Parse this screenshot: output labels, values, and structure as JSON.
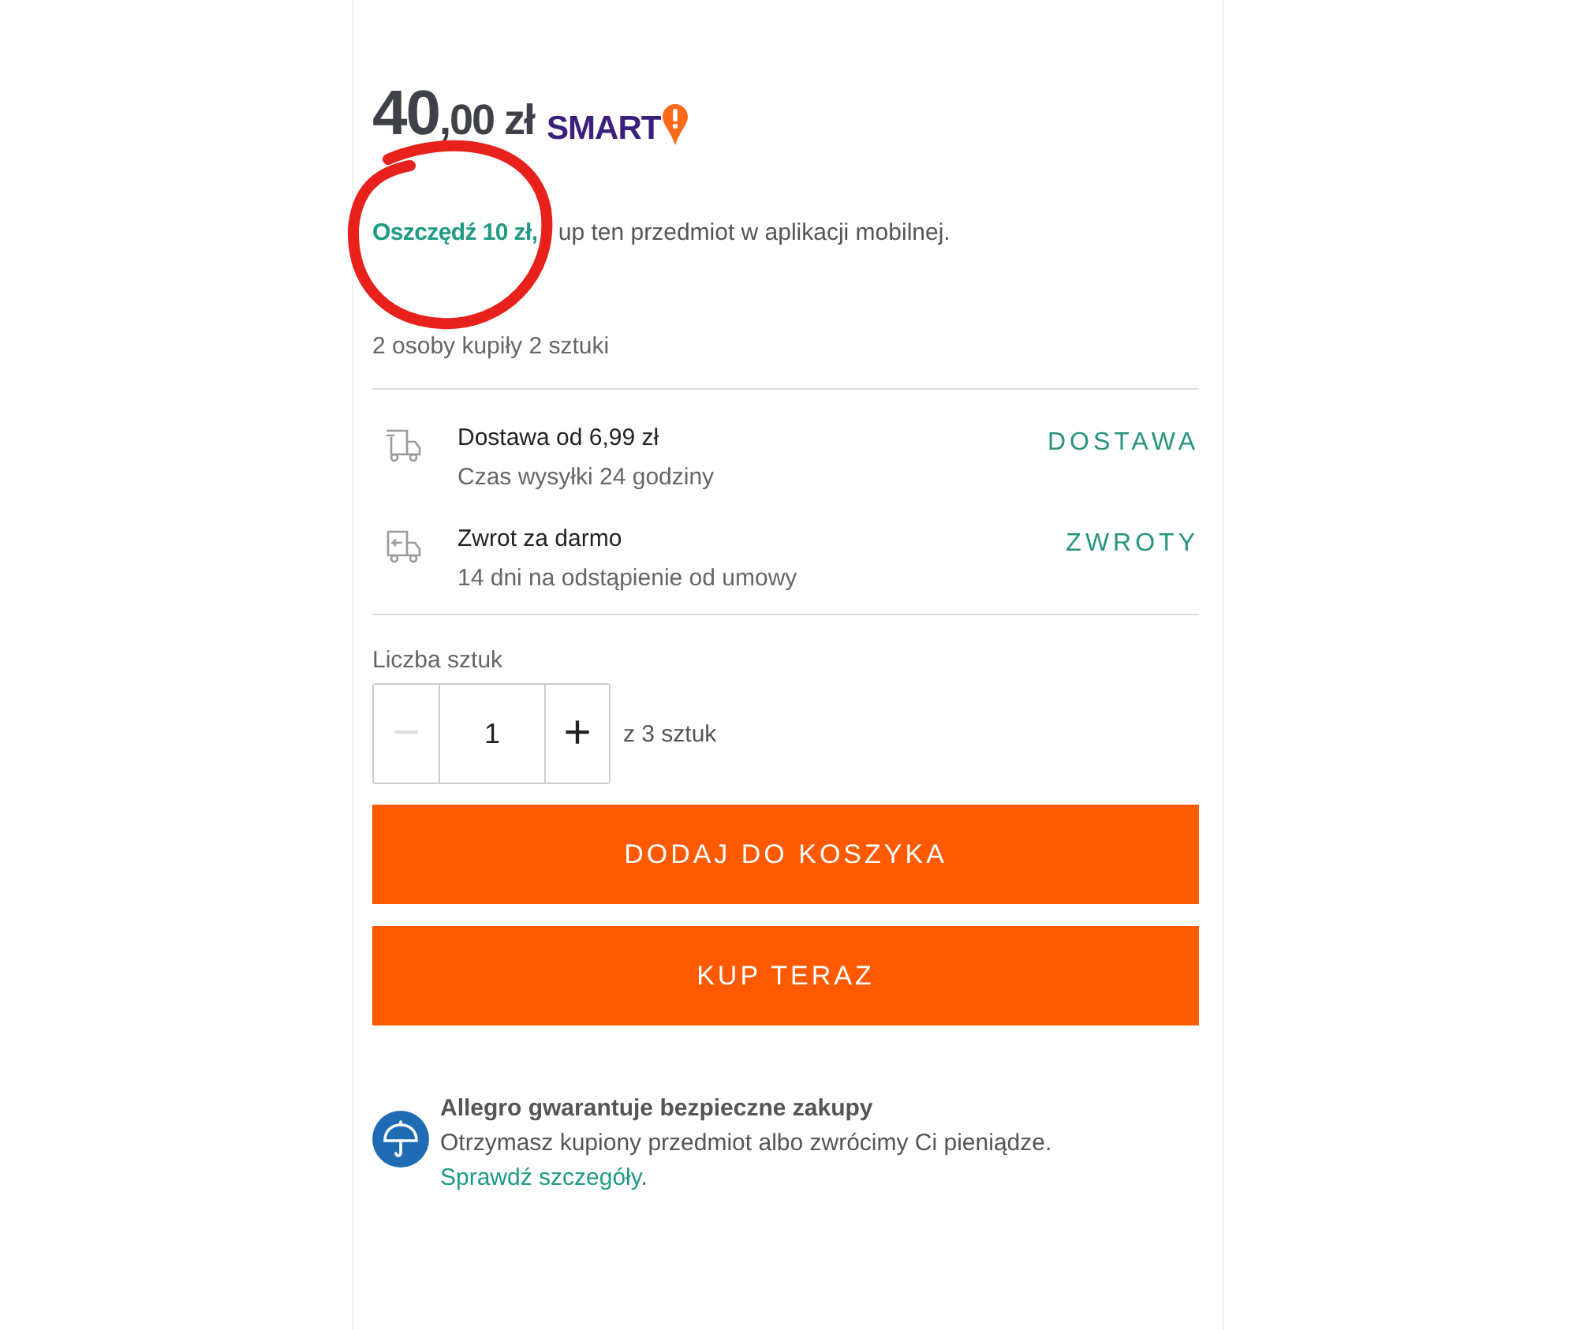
{
  "price": {
    "whole": "40",
    "fraction": ",00 zł",
    "badge": "SMART"
  },
  "promo": "**Oszczędź 10 zł,** up ten przedmiot w aplikacji mobilnej.",
  "annotation": {
    "kind": "circle",
    "color": "#e8211c"
  },
  "buyers": "2 osoby kupiły 2 sztuki",
  "info_rows": [
    {
      "kind": "delivery",
      "title": "Dostawa od 6,99 zł",
      "subtitle": "Czas wysyłki 24 godziny",
      "link": "DOSTAWA"
    },
    {
      "kind": "returns",
      "title": "Zwrot za darmo",
      "subtitle": "14 dni na odstąpienie od umowy",
      "link": "ZWROTY"
    }
  ],
  "quantity": {
    "label": "Liczba sztuk",
    "value": "1",
    "minus": "−",
    "plus": "+",
    "minus_disabled": true,
    "available": "z 3 sztuk"
  },
  "buttons": [
    "DODAJ DO KOSZYKA",
    "KUP TERAZ"
  ],
  "guarantee": {
    "title": "Allegro gwarantuje bezpieczne zakupy",
    "text": "Otrzymasz kupiony przedmiot albo zwrócimy Ci pieniądze.",
    "link": "Sprawdź szczegóły",
    "after": "."
  }
}
